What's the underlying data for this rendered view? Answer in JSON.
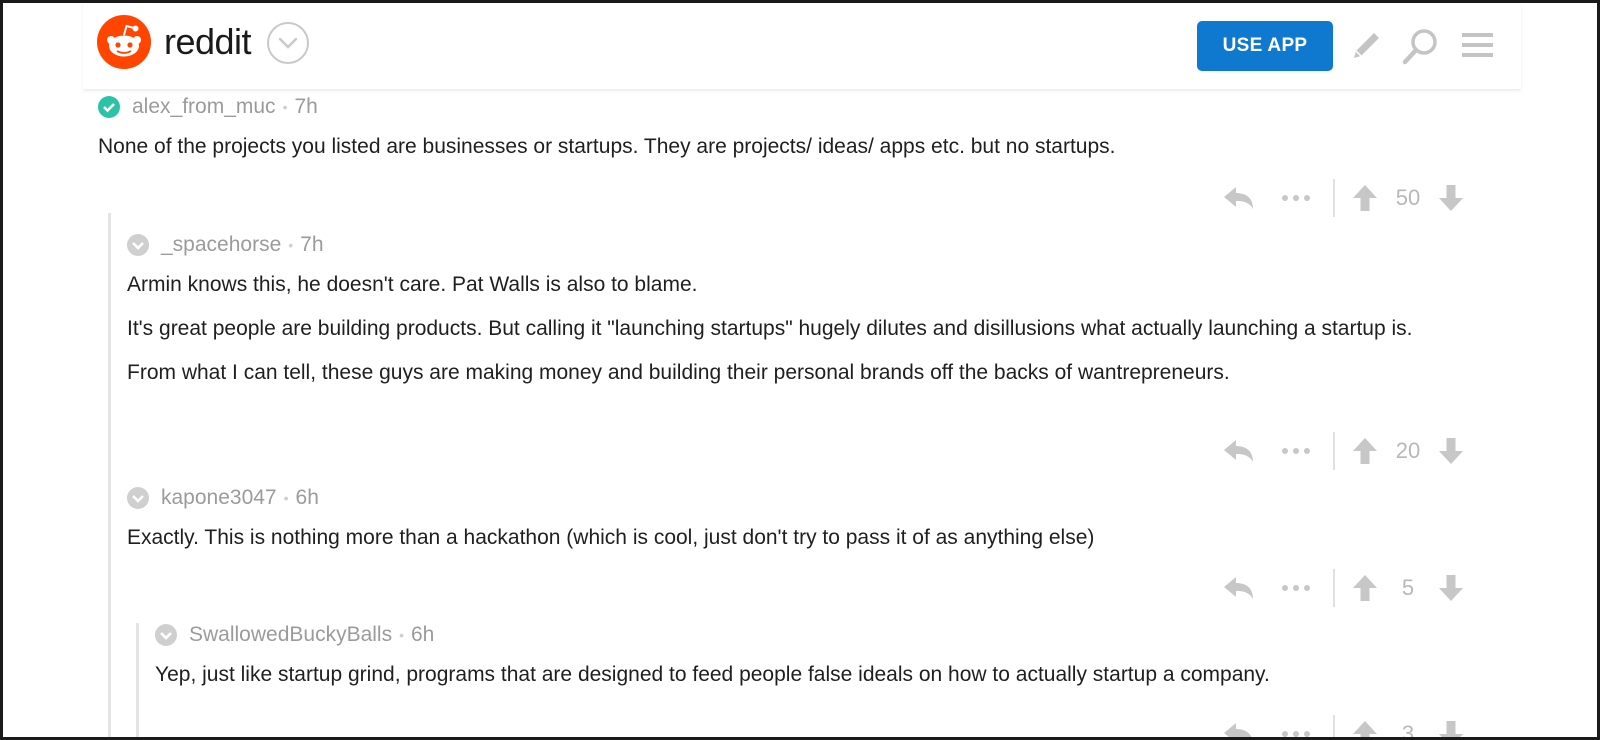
{
  "header": {
    "wordmark": "reddit",
    "use_app_label": "USE APP",
    "brand_color": "#ff4500",
    "accent_color": "#0f79d0",
    "icons": [
      "reddit-snoo-icon",
      "chevron-down-icon",
      "pencil-icon",
      "search-icon",
      "menu-icon"
    ]
  },
  "comments": [
    {
      "username": "alex_from_muc",
      "age": "7h",
      "verified": true,
      "paragraphs": [
        "None of the projects you listed are businesses or startups. They are projects/ ideas/ apps etc. but no startups."
      ],
      "score": "50"
    },
    {
      "username": "_spacehorse",
      "age": "7h",
      "verified": false,
      "paragraphs": [
        "Armin knows this, he doesn't care. Pat Walls is also to blame.",
        "It's great people are building products. But calling it \"launching startups\" hugely dilutes and disillusions what actually launching a startup is.",
        "From what I can tell, these guys are making money and building their personal brands off the backs of wantrepreneurs."
      ],
      "score": "20"
    },
    {
      "username": "kapone3047",
      "age": "6h",
      "verified": false,
      "paragraphs": [
        "Exactly. This is nothing more than a hackathon (which is cool, just don't try to pass it of as anything else)"
      ],
      "score": "5"
    },
    {
      "username": "SwallowedBuckyBalls",
      "age": "6h",
      "verified": false,
      "paragraphs": [
        "Yep, just like startup grind, programs that are designed to feed people false ideals on how to actually startup a company."
      ],
      "score": "3"
    }
  ]
}
